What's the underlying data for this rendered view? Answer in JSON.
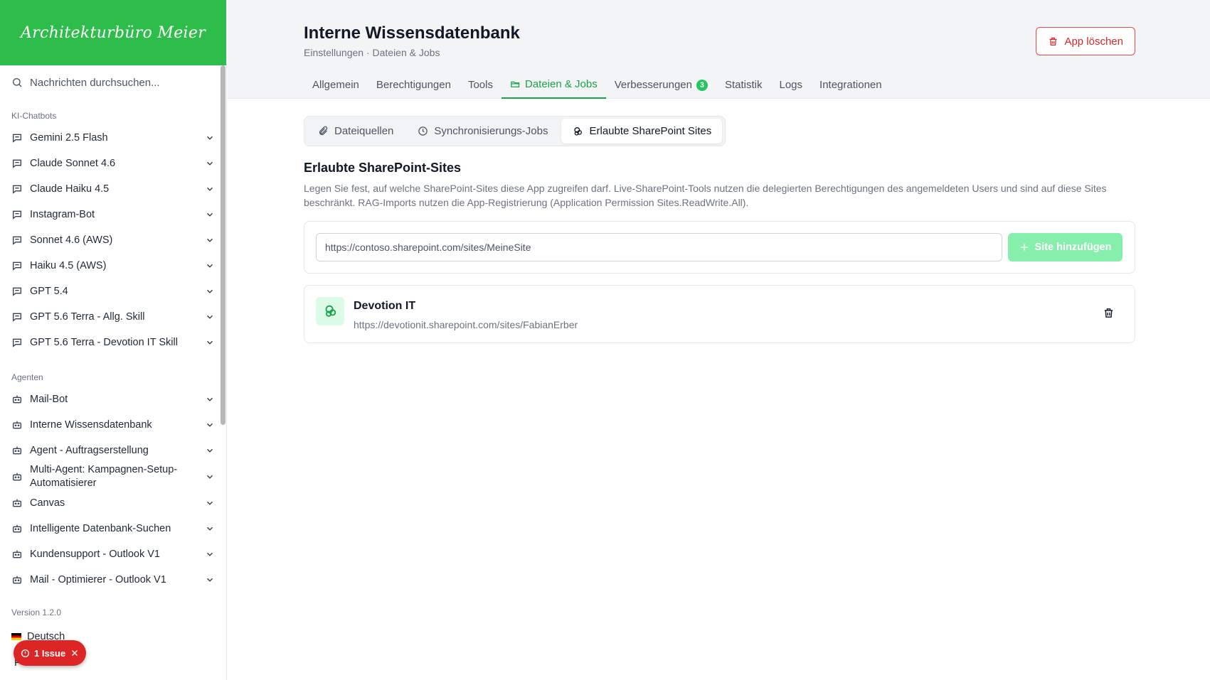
{
  "sidebar": {
    "logo": "Architekturbüro Meier",
    "search_placeholder": "Nachrichten durchsuchen...",
    "chatbots_label": "KI-Chatbots",
    "chatbots": [
      {
        "label": "Gemini 2.5 Flash"
      },
      {
        "label": "Claude Sonnet 4.6"
      },
      {
        "label": "Claude Haiku 4.5"
      },
      {
        "label": "Instagram-Bot"
      },
      {
        "label": "Sonnet 4.6 (AWS)"
      },
      {
        "label": "Haiku 4.5 (AWS)"
      },
      {
        "label": "GPT 5.4"
      },
      {
        "label": "GPT 5.6 Terra - Allg. Skill"
      },
      {
        "label": "GPT 5.6 Terra - Devotion IT Skill"
      }
    ],
    "agents_label": "Agenten",
    "agents": [
      {
        "label": "Mail-Bot"
      },
      {
        "label": "Interne Wissensdatenbank"
      },
      {
        "label": "Agent - Auftragserstellung"
      },
      {
        "label": "Multi-Agent: Kampagnen-Setup-Automatisierer"
      },
      {
        "label": "Canvas"
      },
      {
        "label": "Intelligente Datenbank-Suchen"
      },
      {
        "label": "Kundensupport - Outlook V1"
      },
      {
        "label": "Mail - Optimierer - Outlook V1"
      }
    ],
    "version": "Version 1.2.0",
    "language": "Deutsch",
    "partial_item": "F        er",
    "issue_badge": "1 Issue"
  },
  "header": {
    "title": "Interne Wissensdatenbank",
    "breadcrumb": "Einstellungen · Dateien & Jobs",
    "delete_app_label": "App löschen",
    "tabs": [
      {
        "label": "Allgemein"
      },
      {
        "label": "Berechtigungen"
      },
      {
        "label": "Tools"
      },
      {
        "label": "Dateien & Jobs"
      },
      {
        "label": "Verbesserungen",
        "badge": "3"
      },
      {
        "label": "Statistik"
      },
      {
        "label": "Logs"
      },
      {
        "label": "Integrationen"
      }
    ]
  },
  "subtabs": [
    {
      "label": "Dateiquellen"
    },
    {
      "label": "Synchronisierungs-Jobs"
    },
    {
      "label": "Erlaubte SharePoint Sites"
    }
  ],
  "content": {
    "section_title": "Erlaubte SharePoint-Sites",
    "section_desc": "Legen Sie fest, auf welche SharePoint-Sites diese App zugreifen darf. Live-SharePoint-Tools nutzen die delegierten Berechtigungen des angemeldeten Users und sind auf diese Sites beschränkt. RAG-Imports nutzen die App-Registrierung (Application Permission Sites.ReadWrite.All).",
    "url_placeholder": "https://contoso.sharepoint.com/sites/MeineSite",
    "add_button_label": "Site hinzufügen",
    "sites": [
      {
        "name": "Devotion IT",
        "url": "https://devotionit.sharepoint.com/sites/FabianErber"
      }
    ]
  },
  "colors": {
    "brand_green": "#2ebd4a",
    "active_tab": "#16a34a",
    "danger": "#dc2626",
    "add_button_disabled": "#86efac"
  }
}
